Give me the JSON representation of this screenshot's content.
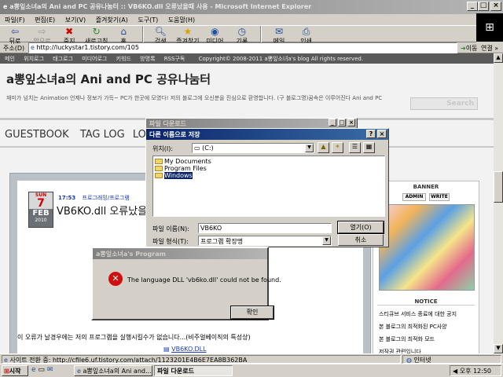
{
  "window": {
    "title": "a뽕잎소녀a의 Ani and PC 공유나눔터 :: VB6KO.dll 오류났을때 사용 - Microsoft Internet Explorer"
  },
  "menubar": [
    "파일(F)",
    "편집(E)",
    "보기(V)",
    "즐겨찾기(A)",
    "도구(T)",
    "도움말(H)"
  ],
  "toolbar": {
    "back": "뒤로",
    "forward": "앞으로",
    "stop": "중지",
    "refresh": "새로고침",
    "home": "홈",
    "search": "검색",
    "favorites": "즐겨찾기",
    "media": "미디어",
    "history": "기록",
    "mail": "메일",
    "print": "인쇄"
  },
  "address": {
    "label": "주소(D)",
    "url": "http://luckystar1.tistory.com/105",
    "go": "이동",
    "links": "연결 »"
  },
  "blog": {
    "nav": [
      "메인",
      "위치로그",
      "태그로그",
      "미디어로그",
      "키워드",
      "방명록",
      "RSS구독"
    ],
    "copyright": "Copyright© 2008-2011 a뽕잎소녀a's blog All rights reserved.",
    "title": "a뽕잎소녀a의 Ani and PC 공유나눔터",
    "description": "재미가 넘치는 Animation 언제나 정보가 가득~ PC가 한곳에 모였다! 저의 블로그에 오신분을 진심으로 환영합니다. (구 블로그명)꿈속은 이루어진다 Ani and PC",
    "search_placeholder": "Search",
    "tabs": [
      "GUESTBOOK",
      "TAG LOG",
      "LOC"
    ],
    "post": {
      "day_name": "SUN",
      "day": "7",
      "month": "FEB",
      "year": "2010",
      "time": "17:53",
      "category": "프로그래밍/프로그램",
      "title": "VB6KO.dll 오류났을",
      "body": "이 오류가 날경우에는 저의 프로그램을 실행시킬수가 없습니다...(비주얼베이직의 특성상)",
      "attachment": "VB6KO.DLL"
    },
    "sidebar": {
      "banner": "BANNER",
      "admin": "ADMIN",
      "write": "WRITE",
      "notice": "NOTICE",
      "notices": [
        "스티큐브 서비스 종료에 대한 공지",
        "본 블로그의 최적화된 PC사양",
        "본 블로그의 최적화 모드",
        "저작권 관련입니다"
      ]
    }
  },
  "download_dialog": {
    "title": "파일 다운로드"
  },
  "save_dialog": {
    "title": "다른 이름으로 저장",
    "location_label": "위치(I):",
    "location_value": "(C:)",
    "files": [
      "My Documents",
      "Program Files",
      "Windows"
    ],
    "selected_file": "Windows",
    "filename_label": "파일 이름(N):",
    "filename_value": "VB6KO",
    "filetype_label": "파일 형식(T):",
    "filetype_value": "프로그램 확장명",
    "open_button": "열기(O)",
    "cancel_button": "취소"
  },
  "error_dialog": {
    "title": "a뽕잎소녀a's Program",
    "message": "The language DLL 'vb6ko.dll' could not be found.",
    "ok_button": "확인"
  },
  "statusbar": {
    "text": "사이트 전환 중: http://cfile6.uf.tistory.com/attach/1123201E4B6E7EA8B362BA",
    "zone": "인터넷"
  },
  "taskbar": {
    "start": "시작",
    "tasks": [
      "a뽕잎소녀a의 Ani and...",
      "파일 다운로드"
    ],
    "clock": "오후 12:50"
  },
  "colors": {
    "titlebar": "#0a246a",
    "blog_bg": "#f2f2f2",
    "error_red": "#d01010",
    "link_blue": "#1a3db8"
  }
}
